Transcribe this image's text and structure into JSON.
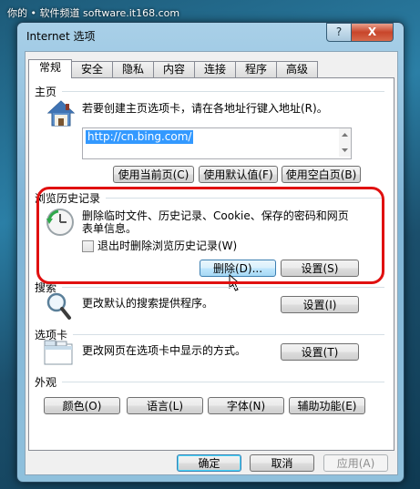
{
  "watermark": "你的 • 软件频道 software.it168.com",
  "window": {
    "title": "Internet 选项",
    "help": "?",
    "close": "X"
  },
  "tabs": [
    "常规",
    "安全",
    "隐私",
    "内容",
    "连接",
    "程序",
    "高级"
  ],
  "home": {
    "heading": "主页",
    "desc": "若要创建主页选项卡，请在各地址行键入地址(R)。",
    "url": "http://cn.bing.com/",
    "btn_current": "使用当前页(C)",
    "btn_default": "使用默认值(F)",
    "btn_blank": "使用空白页(B)"
  },
  "history": {
    "heading": "浏览历史记录",
    "desc": "删除临时文件、历史记录、Cookie、保存的密码和网页表单信息。",
    "checkbox_label": "退出时删除浏览历史记录(W)",
    "btn_delete": "删除(D)...",
    "btn_settings": "设置(S)"
  },
  "search": {
    "heading": "搜索",
    "desc": "更改默认的搜索提供程序。",
    "btn_settings": "设置(I)"
  },
  "tabsect": {
    "heading": "选项卡",
    "desc": "更改网页在选项卡中显示的方式。",
    "btn_settings": "设置(T)"
  },
  "appearance": {
    "heading": "外观",
    "btn_colors": "颜色(O)",
    "btn_languages": "语言(L)",
    "btn_fonts": "字体(N)",
    "btn_access": "辅助功能(E)"
  },
  "footer": {
    "ok": "确定",
    "cancel": "取消",
    "apply": "应用(A)"
  },
  "colors": {
    "highlight_ring": "#e01010",
    "url_selection": "#3399ff"
  }
}
